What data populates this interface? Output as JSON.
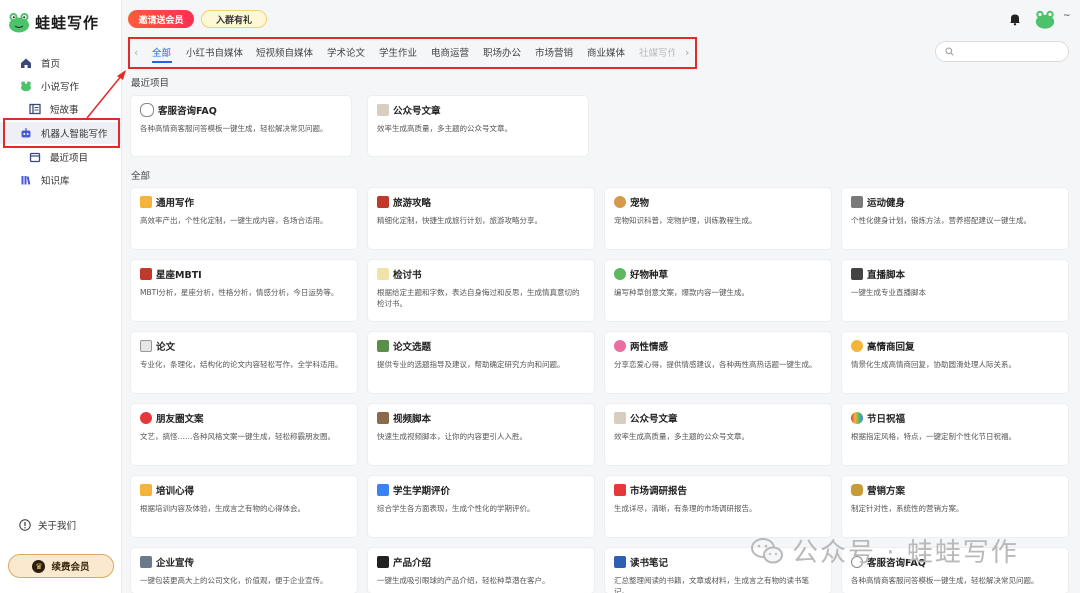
{
  "app": {
    "name": "蛙蛙写作"
  },
  "sidebar": {
    "items": [
      {
        "label": "首页",
        "icon": "home-icon"
      },
      {
        "label": "小说写作",
        "icon": "frog-icon"
      },
      {
        "label": "短故事",
        "icon": "book-icon"
      },
      {
        "label": "机器人智能写作",
        "icon": "robot-icon"
      },
      {
        "label": "最近项目",
        "icon": "folder-icon"
      },
      {
        "label": "知识库",
        "icon": "library-icon"
      }
    ],
    "about": "关于我们",
    "renew": "续费会员"
  },
  "header": {
    "promo_invite": "邀请送会员",
    "promo_group": "入群有礼",
    "user_caret": "~"
  },
  "tabs": [
    "全部",
    "小红书自媒体",
    "短视频自媒体",
    "学术论文",
    "学生作业",
    "电商运营",
    "职场办公",
    "市场营销",
    "商业媒体",
    "社媒写作"
  ],
  "sections": {
    "recent": "最近项目",
    "all": "全部"
  },
  "recent_cards": [
    {
      "title": "客服咨询FAQ",
      "desc": "各种高情商客服问答模板一键生成，轻松解决常见问题。"
    },
    {
      "title": "公众号文章",
      "desc": "效率生成高质量，多主题的公众号文章。"
    }
  ],
  "all_cards": [
    {
      "title": "通用写作",
      "desc": "高效率产出，个性化定制，一键生成内容，各场合适用。"
    },
    {
      "title": "旅游攻略",
      "desc": "精细化定制，快捷生成旅行计划，旅游攻略分享。"
    },
    {
      "title": "宠物",
      "desc": "宠物知识科普，宠物护理，训练教程生成。"
    },
    {
      "title": "运动健身",
      "desc": "个性化健身计划，锻炼方法，营养搭配建议一键生成。"
    },
    {
      "title": "星座MBTI",
      "desc": "MBTI分析，星座分析，性格分析，情感分析，今日运势等。"
    },
    {
      "title": "检讨书",
      "desc": "根据给定主题和字数，表达自身悔过和反思，生成情真意切的检讨书。"
    },
    {
      "title": "好物种草",
      "desc": "编写种草创意文案，爆款内容一键生成。"
    },
    {
      "title": "直播脚本",
      "desc": "一键生成专业直播脚本"
    },
    {
      "title": "论文",
      "desc": "专业化，条理化，结构化的论文内容轻松写作，全学科适用。"
    },
    {
      "title": "论文选题",
      "desc": "提供专业的选题指导及建议，帮助确定研究方向和问题。"
    },
    {
      "title": "两性情感",
      "desc": "分享恋爱心得，提供情感建议，各种两性高热话题一键生成。"
    },
    {
      "title": "高情商回复",
      "desc": "情景化生成高情商回复，协助圆滑处理人际关系。"
    },
    {
      "title": "朋友圈文案",
      "desc": "文艺，搞怪……各种风格文案一键生成，轻松称霸朋友圈。"
    },
    {
      "title": "视频脚本",
      "desc": "快速生成视频脚本，让你的内容更引人入胜。"
    },
    {
      "title": "公众号文章",
      "desc": "效率生成高质量，多主题的公众号文章。"
    },
    {
      "title": "节日祝福",
      "desc": "根据指定风格，特点，一键定制个性化节日祝福。"
    },
    {
      "title": "培训心得",
      "desc": "根据培训内容及体验，生成言之有物的心得体会。"
    },
    {
      "title": "学生学期评价",
      "desc": "综合学生各方面表现，生成个性化的学期评价。"
    },
    {
      "title": "市场调研报告",
      "desc": "生成详尽，清晰，有条理的市场调研报告。"
    },
    {
      "title": "营销方案",
      "desc": "制定针对性，系统性的营销方案。"
    },
    {
      "title": "企业宣传",
      "desc": "一键包装更高大上的公司文化，价值观，便于企业宣传。"
    },
    {
      "title": "产品介绍",
      "desc": "一键生成吸引眼球的产品介绍，轻松种草潜在客户。"
    },
    {
      "title": "读书笔记",
      "desc": "汇总整理阅读的书籍，文章或材料，生成言之有物的读书笔记。"
    },
    {
      "title": "客服咨询FAQ",
      "desc": "各种高情商客服问答模板一键生成，轻松解决常见问题。"
    }
  ],
  "watermark": "公众号 · 蛙蛙写作",
  "colors": {
    "accent": "#2563eb",
    "highlight": "#e02b2b",
    "brand_green": "#4cc26a"
  }
}
